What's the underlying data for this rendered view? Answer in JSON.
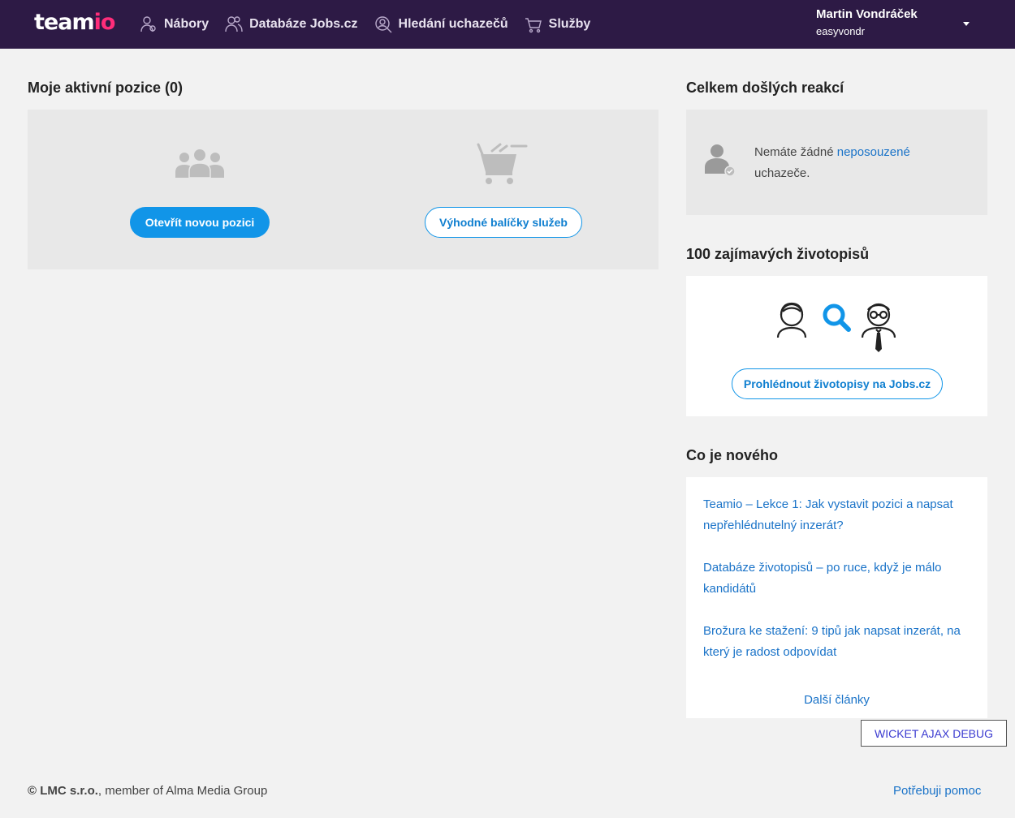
{
  "header": {
    "logo_main": "team",
    "logo_accent": "io",
    "nav": [
      {
        "label": "Nábory",
        "icon": "user-recruit-icon"
      },
      {
        "label": "Databáze Jobs.cz",
        "icon": "users-database-icon"
      },
      {
        "label": "Hledání uchazečů",
        "icon": "user-search-icon"
      },
      {
        "label": "Služby",
        "icon": "cart-icon"
      }
    ],
    "user_name": "Martin Vondráček",
    "user_login": "easyvondr"
  },
  "positions": {
    "title": "Moje aktivní pozice (0)",
    "open_button": "Otevřít novou pozici",
    "packages_button": "Výhodné balíčky služeb"
  },
  "replies": {
    "title": "Celkem došlých reakcí",
    "text_before": "Nemáte žádné ",
    "link": "neposouzené",
    "text_after": "uchazeče."
  },
  "cvs": {
    "title": "100 zajímavých životopisů",
    "button": "Prohlédnout životopisy na Jobs.cz"
  },
  "news": {
    "title": "Co je nového",
    "items": [
      "Teamio – Lekce 1: Jak vystavit pozici a napsat nepřehlédnutelný inzerát?",
      "Databáze životopisů – po ruce, když je málo kandidátů",
      "Brožura ke stažení: 9 tipů jak napsat inzerát, na který je radost odpovídat"
    ],
    "more": "Další články"
  },
  "debug_button": "WICKET AJAX DEBUG",
  "footer": {
    "company": "© LMC s.r.o.",
    "company_suffix": ", member of Alma Media Group",
    "help": "Potřebuji pomoc"
  },
  "colors": {
    "header_bg": "#2d1a45",
    "accent_pink": "#ff2d7a",
    "primary_blue": "#1195e8",
    "link_blue": "#1a73c8"
  }
}
